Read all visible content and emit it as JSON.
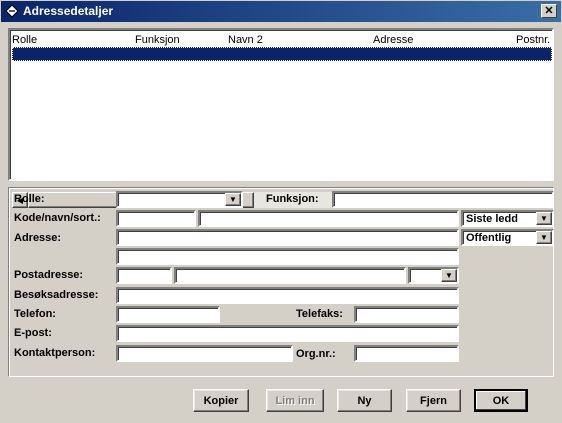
{
  "window": {
    "title": "Adressedetaljer",
    "close_glyph": "✕"
  },
  "list": {
    "columns": [
      "Rolle",
      "Funksjon",
      "Navn 2",
      "Adresse",
      "Postnr."
    ]
  },
  "form": {
    "rolle_label": "Rolle:",
    "funksjon_label": "Funksjon:",
    "kode_label": "Kode/navn/sort.:",
    "adresse_label": "Adresse:",
    "postadresse_label": "Postadresse:",
    "besoksadresse_label": "Besøksadresse:",
    "telefon_label": "Telefon:",
    "telefaks_label": "Telefaks:",
    "epost_label": "E-post:",
    "kontaktperson_label": "Kontaktperson:",
    "orgnr_label": "Org.nr.:",
    "sort_select_value": "Siste ledd",
    "visibility_select_value": "Offentlig"
  },
  "buttons": {
    "kopier": "Kopier",
    "lim_inn": "Lim inn",
    "ny": "Ny",
    "fjern": "Fjern",
    "ok": "OK"
  },
  "colors": {
    "title_bar": "#0a246a",
    "selection": "#0a246a",
    "face": "#d4d0c8"
  }
}
